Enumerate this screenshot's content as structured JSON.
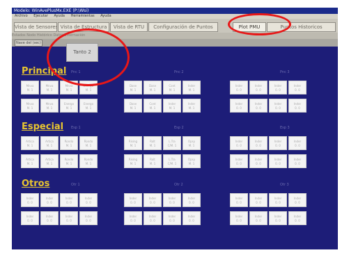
{
  "window": {
    "title": "Modelo: WinAvePlusMx.EXE (P:\\Wsi)",
    "menu": [
      "Archivo",
      "Ejecutar",
      "Ayuda",
      "Herramientas",
      "Ayuda"
    ]
  },
  "tabs": [
    {
      "label": "Vista de Sensores"
    },
    {
      "label": "Vista de Estructura"
    },
    {
      "label": "Vista de RTU"
    },
    {
      "label": "Configuración de Puntos"
    },
    {
      "label": "Plot PMU"
    },
    {
      "label": "Puntos Historicos"
    }
  ],
  "subbar_text": "Estados   Nodo Histórico   Datos Información",
  "subtabs": [
    {
      "label": "Nave del (sec)"
    }
  ],
  "popup": {
    "label": "Tanto 2"
  },
  "sections": [
    {
      "title": "Principal",
      "groups": [
        {
          "label": "Pnc 1",
          "rows": [
            [
              "Mnva\nM. 1",
              "Mnva\nM. 1",
              "Mnva\nM. 1",
              "Energo\nM. 1"
            ],
            [
              "Mnva\nM. 1",
              "Mnva\nM. 1",
              "Energo\nM. 1",
              "Energo\nM. 1"
            ]
          ]
        },
        {
          "label": "Pnc 2",
          "rows": [
            [
              "Dase\nM. 1",
              "Dase\nM. 1",
              "Cont\nM. 1",
              "Inder\nM. 1"
            ],
            [
              "Dase\nM. 1",
              "Cont\nM. 1",
              "Inder\nM. 1",
              "Inder\nM. 1"
            ]
          ]
        },
        {
          "label": "Pnc 3",
          "rows": [
            [
              "Inder\n0. 0",
              "Inder\n0. 0",
              "Inder\n0. 0",
              "Inder\n0. 0"
            ],
            [
              "Inder\n0. 0",
              "Inder\n0. 0",
              "Inder\n0. 0",
              "Inder\n0. 0"
            ]
          ]
        }
      ]
    },
    {
      "title": "Especial",
      "groups": [
        {
          "label": "Esp 1",
          "rows": [
            [
              "Artica\nM. 1",
              "Artica\nM. 1",
              "Rondo\nM. 1",
              "Rondo\nM. 1"
            ],
            [
              "Artica\nM. 1",
              "Artica\nM. 1",
              "Rondo\nM. 1",
              "Rondo\nM. 1"
            ]
          ]
        },
        {
          "label": "Esp 2",
          "rows": [
            [
              "Rising\nM. 1",
              "Rolt\nM. 1",
              "L.Tra\nC/M. 1",
              "Opsy\nM. 1"
            ],
            [
              "Rising\nM. 1",
              "Rolt\nM. 1",
              "L.Tra\nC/M. 1",
              "Opsy\nM. 1"
            ]
          ]
        },
        {
          "label": "Esp 3",
          "rows": [
            [
              "Inder\n0. 0",
              "Inder\n0. 0",
              "Inder\n0. 0",
              "Inder\n0. 0"
            ],
            [
              "Inder\n0. 0",
              "Inder\n0. 0",
              "Inder\n0. 0",
              "Inder\n0. 0"
            ]
          ]
        }
      ]
    },
    {
      "title": "Otros",
      "groups": [
        {
          "label": "Otr 1",
          "rows": [
            [
              "Inder\n0. 0",
              "Inder\n0. 0",
              "Inder\n0. 0",
              "Inder\n0. 0"
            ],
            [
              "Inder\n0. 0",
              "Inder\n0. 0",
              "Inder\n0. 0",
              "Inder\n0. 0"
            ]
          ]
        },
        {
          "label": "Otr 2",
          "rows": [
            [
              "Inder\n0. 0",
              "Inder\n0. 0",
              "Inder\n0. 0",
              "Inder\n0. 0"
            ],
            [
              "Inder\n0. 0",
              "Inder\n0. 0",
              "Inder\n0. 0",
              "Inder\n0. 0"
            ]
          ]
        },
        {
          "label": "Otr 3",
          "rows": [
            [
              "Inder\n0. 0",
              "Inder\n0. 0",
              "Inder\n0. 0",
              "Inder\n0. 0"
            ],
            [
              "Inder\n0. 0",
              "Inder\n0. 0",
              "Inder\n0. 0",
              "Inder\n0. 0"
            ]
          ]
        }
      ]
    }
  ],
  "colors": {
    "panel": "#1d1d78",
    "section_title": "#e8c530",
    "annotation": "#e81717"
  }
}
